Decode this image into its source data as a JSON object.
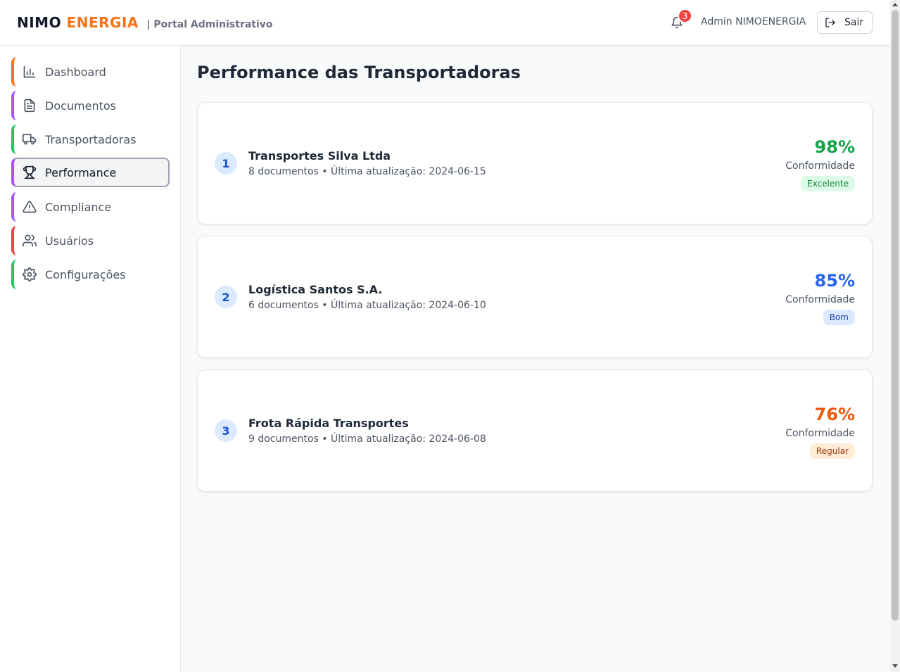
{
  "header": {
    "brand_primary": "NIMO",
    "brand_accent": "ENERGIA",
    "brand_subtitle": "| Portal Administrativo",
    "notification_count": "3",
    "user_name": "Admin NIMOENERGIA",
    "logout_label": "Sair"
  },
  "sidebar": {
    "items": [
      {
        "label": "Dashboard",
        "icon": "bar-chart-icon",
        "accent": "#f97316"
      },
      {
        "label": "Documentos",
        "icon": "document-icon",
        "accent": "#a855f7"
      },
      {
        "label": "Transportadoras",
        "icon": "truck-icon",
        "accent": "#22c55e"
      },
      {
        "label": "Performance",
        "icon": "trophy-icon",
        "accent": "#a855f7",
        "active": true
      },
      {
        "label": "Compliance",
        "icon": "warning-icon",
        "accent": "#a855f7"
      },
      {
        "label": "Usuários",
        "icon": "users-icon",
        "accent": "#ef4444"
      },
      {
        "label": "Configurações",
        "icon": "gear-icon",
        "accent": "#22c55e"
      }
    ]
  },
  "main": {
    "title": "Performance das Transportadoras",
    "carriers": [
      {
        "rank": "1",
        "name": "Transportes Silva Ltda",
        "meta": "8 documentos • Última atualização: 2024-06-15",
        "percent": "98%",
        "metric_label": "Conformidade",
        "rating": "Excelente",
        "color": "#16a34a",
        "badge_bg": "#dcfce7",
        "badge_fg": "#15803d"
      },
      {
        "rank": "2",
        "name": "Logística Santos S.A.",
        "meta": "6 documentos • Última atualização: 2024-06-10",
        "percent": "85%",
        "metric_label": "Conformidade",
        "rating": "Bom",
        "color": "#2563eb",
        "badge_bg": "#dbeafe",
        "badge_fg": "#1e40af"
      },
      {
        "rank": "3",
        "name": "Frota Rápida Transportes",
        "meta": "9 documentos • Última atualização: 2024-06-08",
        "percent": "76%",
        "metric_label": "Conformidade",
        "rating": "Regular",
        "color": "#ea580c",
        "badge_bg": "#ffedd5",
        "badge_fg": "#9a3412"
      }
    ]
  }
}
